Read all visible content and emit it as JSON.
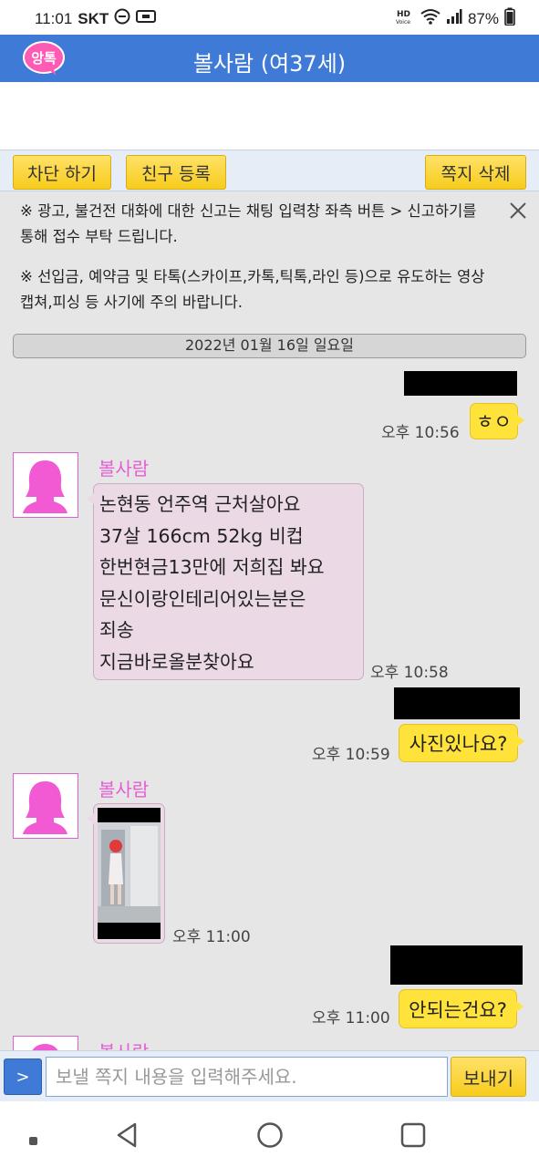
{
  "status_bar": {
    "time": "11:01",
    "carrier": "SKT",
    "hd_voice": "HD",
    "battery": "87%"
  },
  "app": {
    "logo_text": "앙톡",
    "title": "볼사람 (여37세)"
  },
  "toolbar": {
    "block_label": "차단 하기",
    "friend_label": "친구 등록",
    "delete_label": "쪽지 삭제"
  },
  "notice": {
    "para1": "※ 광고, 불건전 대화에 대한 신고는 채팅 입력창 좌측 버튼 > 신고하기를 통해 접수 부탁 드립니다.",
    "para2": "※ 선입금, 예약금 및 타톡(스카이프,카톡,틱톡,라인 등)으로 유도하는 영상캡쳐,피싱 등 사기에 주의 바랍니다."
  },
  "chat": {
    "date": "2022년 01월 16일 일요일",
    "messages": [
      {
        "from": "me",
        "text": "ㅎㅇ",
        "time": "오후 10:56"
      },
      {
        "from": "them",
        "sender": "볼사람",
        "lines": [
          "논현동 언주역 근처살아요",
          "37살 166cm 52kg 비컵",
          "한번현금13만에 저희집 봐요",
          "문신이랑인테리어있는분은",
          "죄송",
          "지금바로올분찾아요"
        ],
        "time": "오후 10:58"
      },
      {
        "from": "me",
        "text": "사진있나요?",
        "time": "오후 10:59"
      },
      {
        "from": "them",
        "sender": "볼사람",
        "type": "photo",
        "time": "오후 11:00"
      },
      {
        "from": "me",
        "text": "안되는건요?",
        "time": "오후 11:00"
      },
      {
        "from": "them",
        "sender": "볼사람"
      }
    ]
  },
  "input": {
    "report_label": ">",
    "placeholder": "보낼 쪽지 내용을 입력해주세요.",
    "send_label": "보내기"
  },
  "colors": {
    "header_blue": "#3e7ad6",
    "my_bubble": "#ffe23a",
    "their_bubble": "#ecd9e6",
    "sender_pink": "#e45ed2",
    "button_yellow": "#f7cc1c"
  }
}
